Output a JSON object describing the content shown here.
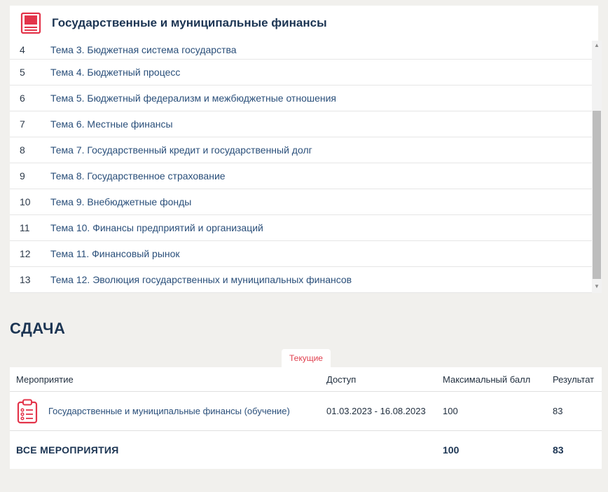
{
  "course": {
    "title": "Государственные и муниципальные финансы",
    "icon": "book-icon",
    "accent_color": "#e3344a"
  },
  "topics": [
    {
      "num": "4",
      "name": "Тема 3. Бюджетная система государства"
    },
    {
      "num": "5",
      "name": "Тема 4. Бюджетный процесс"
    },
    {
      "num": "6",
      "name": "Тема 5. Бюджетный федерализм и межбюджетные отношения"
    },
    {
      "num": "7",
      "name": "Тема 6. Местные финансы"
    },
    {
      "num": "8",
      "name": "Тема 7. Государственный кредит и государственный долг"
    },
    {
      "num": "9",
      "name": "Тема 8. Государственное страхование"
    },
    {
      "num": "10",
      "name": "Тема 9. Внебюджетные фонды"
    },
    {
      "num": "11",
      "name": "Тема 10. Финансы предприятий и организаций"
    },
    {
      "num": "12",
      "name": "Тема 11. Финансовый рынок"
    },
    {
      "num": "13",
      "name": "Тема 12. Эволюция государственных и муниципальных финансов"
    }
  ],
  "submission": {
    "title": "СДАЧА",
    "tab_label": "Текущие",
    "columns": {
      "event": "Мероприятие",
      "access": "Доступ",
      "max_score": "Максимальный балл",
      "result": "Результат"
    },
    "rows": [
      {
        "event": "Государственные и муниципальные финансы (обучение)",
        "access": "01.03.2023 - 16.08.2023",
        "max_score": "100",
        "result": "83",
        "icon": "clipboard-list-icon"
      }
    ],
    "total": {
      "label": "ВСЕ МЕРОПРИЯТИЯ",
      "max_score": "100",
      "result": "83"
    }
  }
}
